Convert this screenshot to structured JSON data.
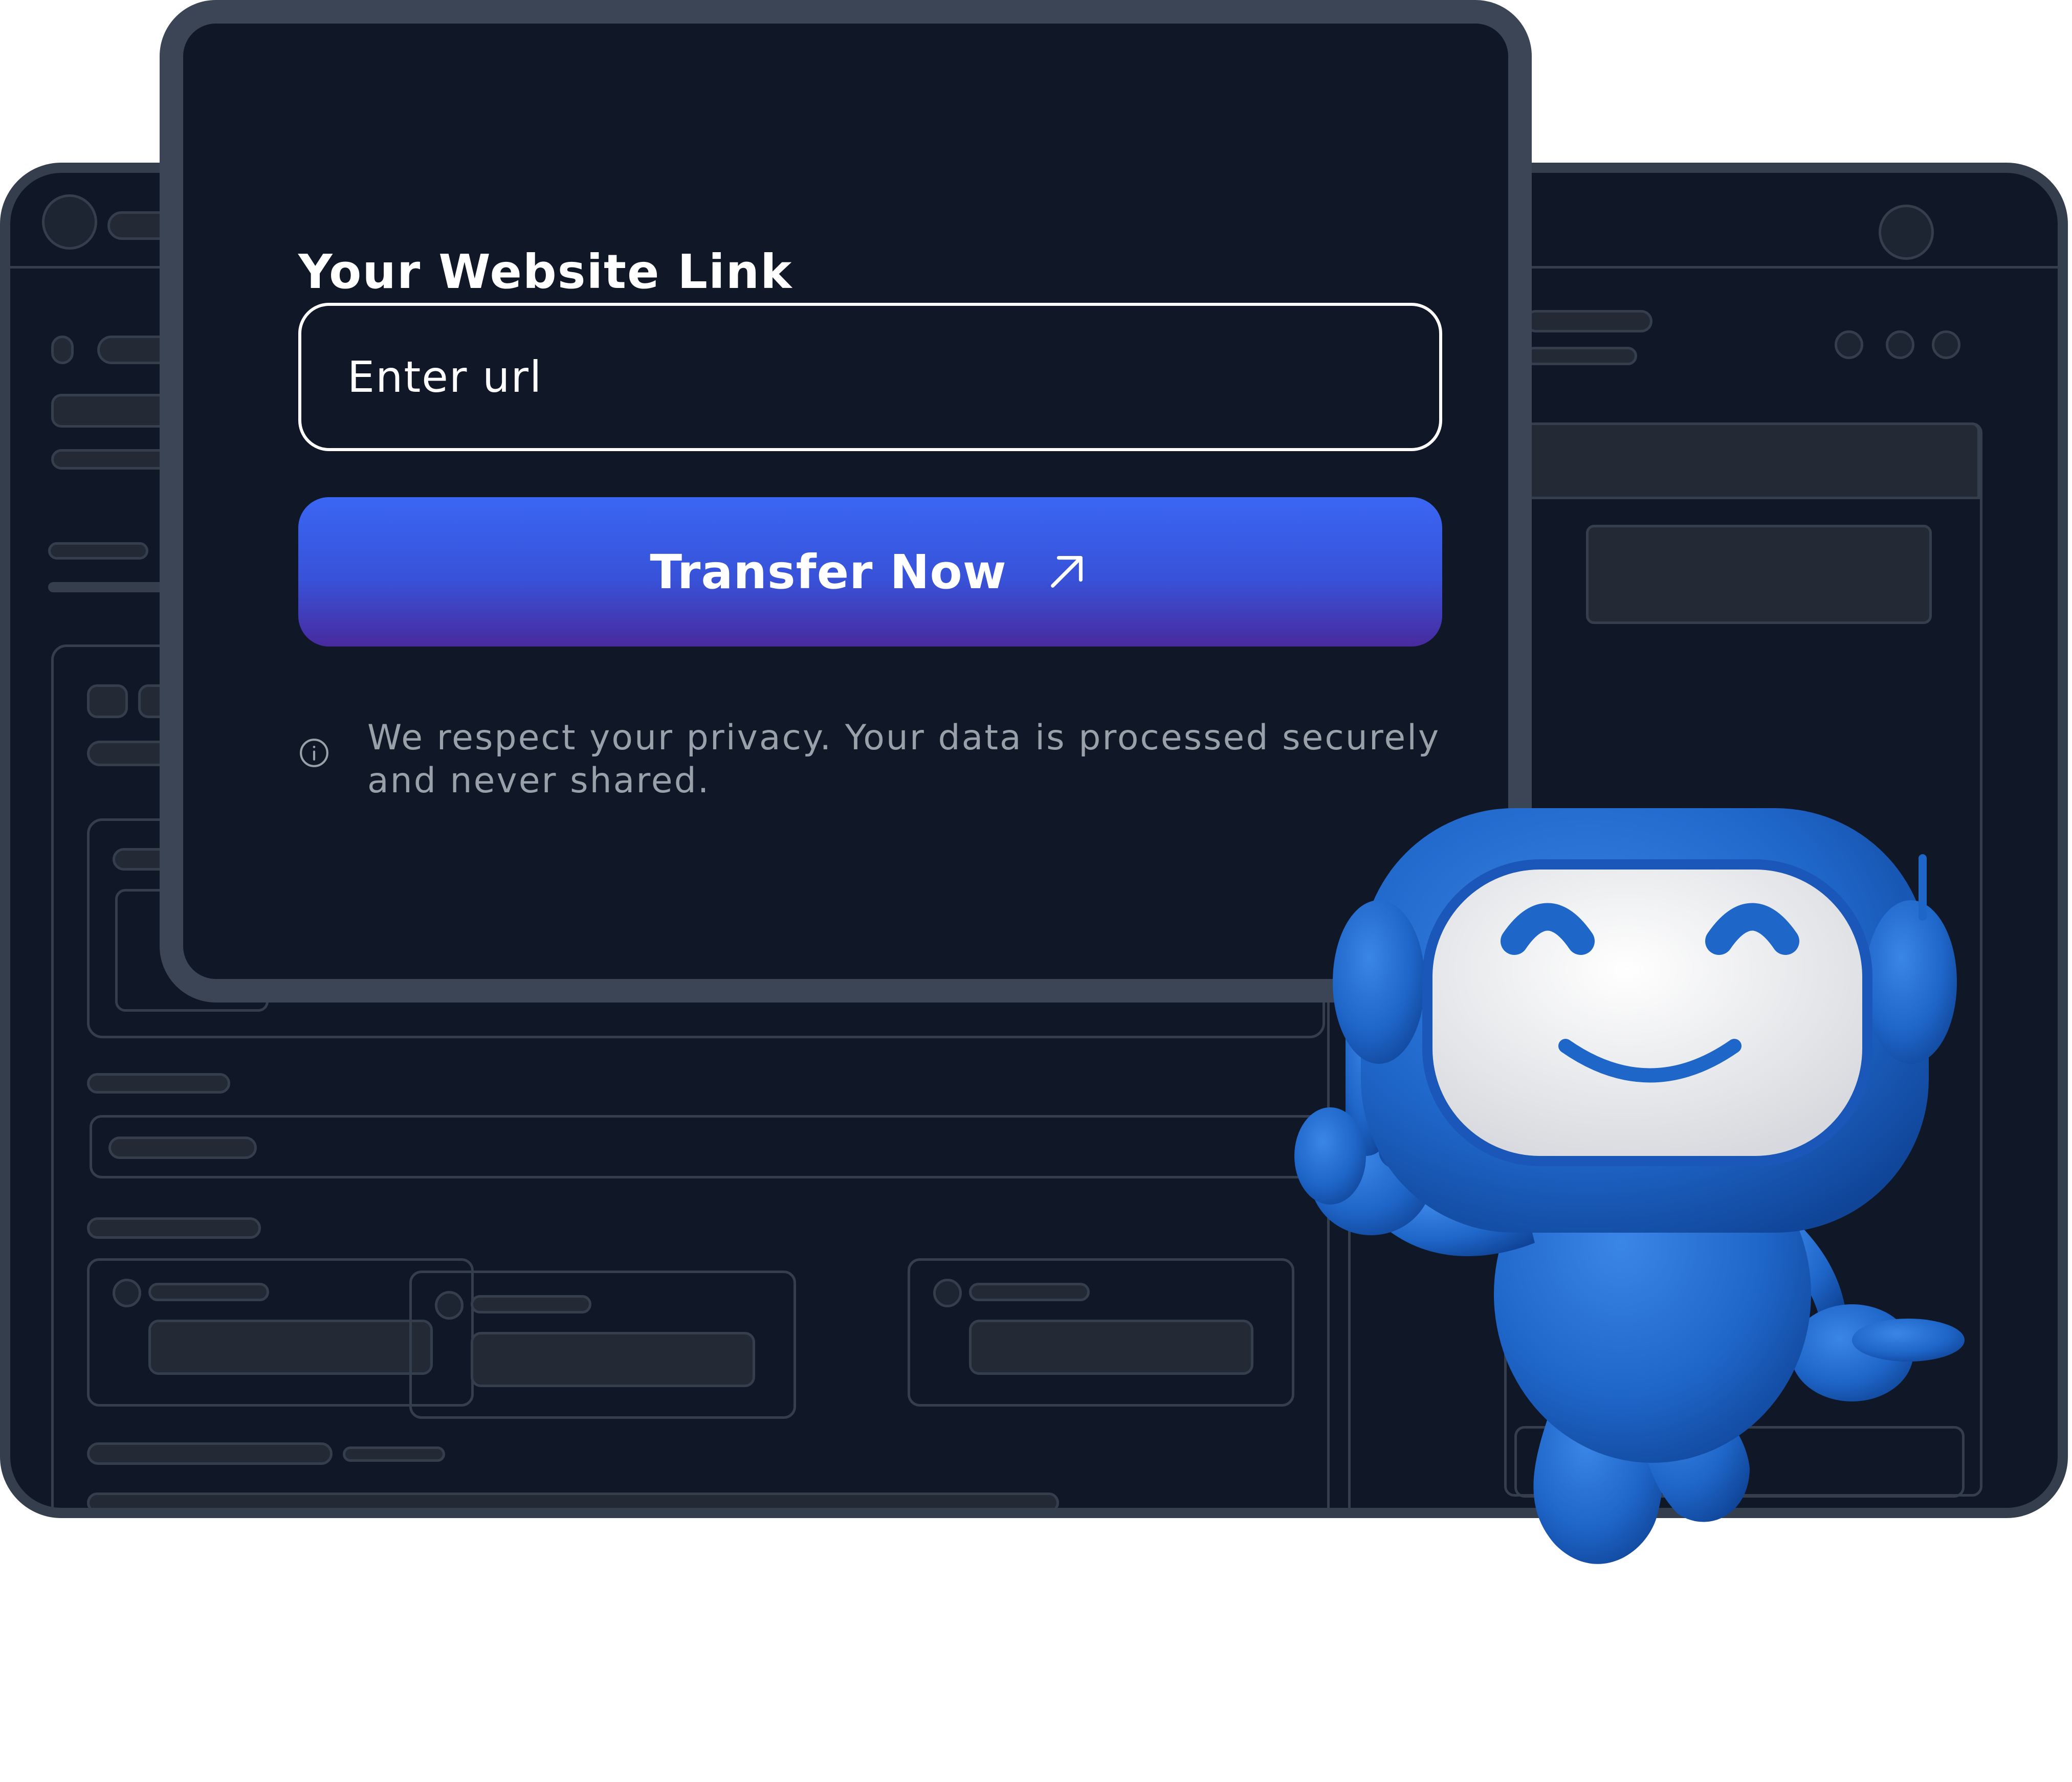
{
  "form": {
    "title": "Your Website Link",
    "url_placeholder": "Enter url",
    "url_value": "",
    "submit_label": "Transfer Now",
    "submit_icon": "arrow-up-right-icon",
    "privacy_icon": "info-icon",
    "privacy_note": "We respect your privacy. Your data is processed securely and never shared."
  },
  "colors": {
    "page_background": "#ffffff",
    "window_background": "#101827",
    "window_border": "#3c4556",
    "button_gradient_top": "#3a66f4",
    "button_gradient_bottom": "#482a9e",
    "privacy_text": "#9aa0aa",
    "mascot_blue": "#1f66c9"
  },
  "illustration": {
    "mascot": "smiling-robot-mascot",
    "background_window": "app-wireframe-mockup"
  }
}
